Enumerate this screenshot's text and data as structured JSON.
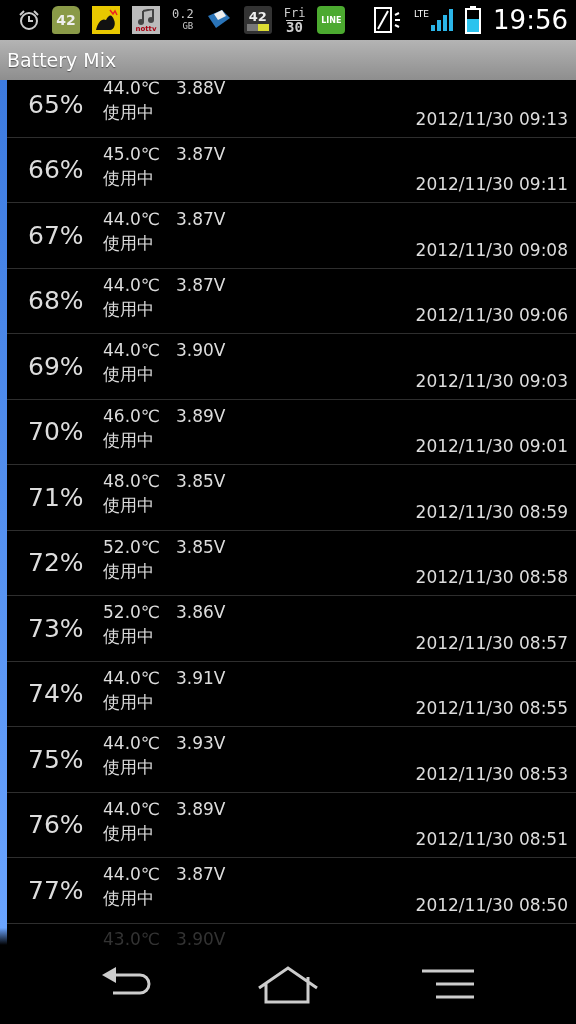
{
  "status_bar": {
    "android_badge": "42",
    "tv_label": "nottv",
    "storage": {
      "value": "0.2",
      "unit": "GB"
    },
    "battery_widget": "42",
    "day": {
      "weekday": "Fri",
      "date": "30"
    },
    "chat_label": "LINE",
    "network": "LTE",
    "time": "19:56"
  },
  "title_bar": {
    "title": "Battery Mix"
  },
  "rows": [
    {
      "percent": "65%",
      "temperature": "44.0℃",
      "voltage": "3.88V",
      "status": "使用中",
      "timestamp": "2012/11/30 09:13"
    },
    {
      "percent": "66%",
      "temperature": "45.0℃",
      "voltage": "3.87V",
      "status": "使用中",
      "timestamp": "2012/11/30 09:11"
    },
    {
      "percent": "67%",
      "temperature": "44.0℃",
      "voltage": "3.87V",
      "status": "使用中",
      "timestamp": "2012/11/30 09:08"
    },
    {
      "percent": "68%",
      "temperature": "44.0℃",
      "voltage": "3.87V",
      "status": "使用中",
      "timestamp": "2012/11/30 09:06"
    },
    {
      "percent": "69%",
      "temperature": "44.0℃",
      "voltage": "3.90V",
      "status": "使用中",
      "timestamp": "2012/11/30 09:03"
    },
    {
      "percent": "70%",
      "temperature": "46.0℃",
      "voltage": "3.89V",
      "status": "使用中",
      "timestamp": "2012/11/30 09:01"
    },
    {
      "percent": "71%",
      "temperature": "48.0℃",
      "voltage": "3.85V",
      "status": "使用中",
      "timestamp": "2012/11/30 08:59"
    },
    {
      "percent": "72%",
      "temperature": "52.0℃",
      "voltage": "3.85V",
      "status": "使用中",
      "timestamp": "2012/11/30 08:58"
    },
    {
      "percent": "73%",
      "temperature": "52.0℃",
      "voltage": "3.86V",
      "status": "使用中",
      "timestamp": "2012/11/30 08:57"
    },
    {
      "percent": "74%",
      "temperature": "44.0℃",
      "voltage": "3.91V",
      "status": "使用中",
      "timestamp": "2012/11/30 08:55"
    },
    {
      "percent": "75%",
      "temperature": "44.0℃",
      "voltage": "3.93V",
      "status": "使用中",
      "timestamp": "2012/11/30 08:53"
    },
    {
      "percent": "76%",
      "temperature": "44.0℃",
      "voltage": "3.89V",
      "status": "使用中",
      "timestamp": "2012/11/30 08:51"
    },
    {
      "percent": "77%",
      "temperature": "44.0℃",
      "voltage": "3.87V",
      "status": "使用中",
      "timestamp": "2012/11/30 08:50"
    }
  ],
  "cut_row": {
    "temperature": "43.0℃",
    "voltage": "3.90V"
  }
}
